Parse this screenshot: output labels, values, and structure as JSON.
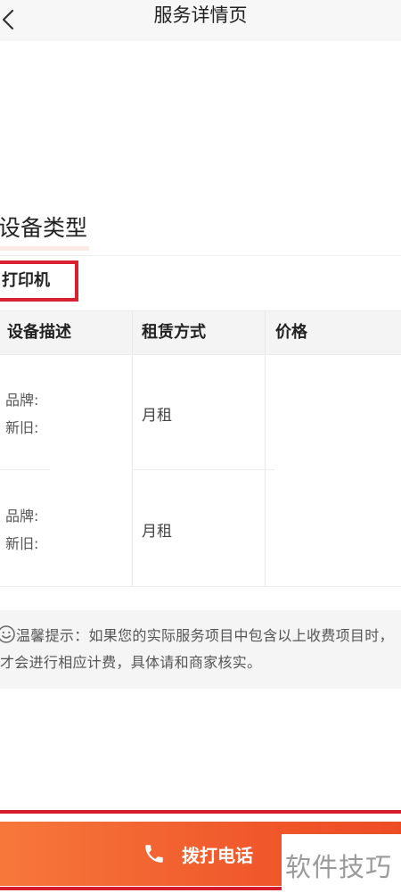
{
  "header": {
    "title": "服务详情页",
    "back_icon": "chevron-left-icon"
  },
  "section": {
    "title": "设备类型"
  },
  "device": {
    "type_label": "打印机"
  },
  "table": {
    "headers": [
      "设备描述",
      "租赁方式",
      "价格"
    ],
    "rows": [
      {
        "brand_label": "品牌:",
        "condition_label": "新旧:",
        "rental_method": "月租",
        "price": ""
      },
      {
        "brand_label": "品牌:",
        "condition_label": "新旧:",
        "rental_method": "月租",
        "price": ""
      }
    ]
  },
  "tip": {
    "icon": "smile-icon",
    "text": "温馨提示：如果您的实际服务项目中包含以上收费项目时，才会进行相应计费，具体请和商家核实。"
  },
  "call_button": {
    "label": "拨打电话",
    "icon": "phone-icon"
  },
  "watermark": {
    "text": "软件技巧"
  },
  "colors": {
    "accent": "#f05a2c",
    "highlight_red": "#d61b2a",
    "header_bg": "#f7f7f7"
  }
}
